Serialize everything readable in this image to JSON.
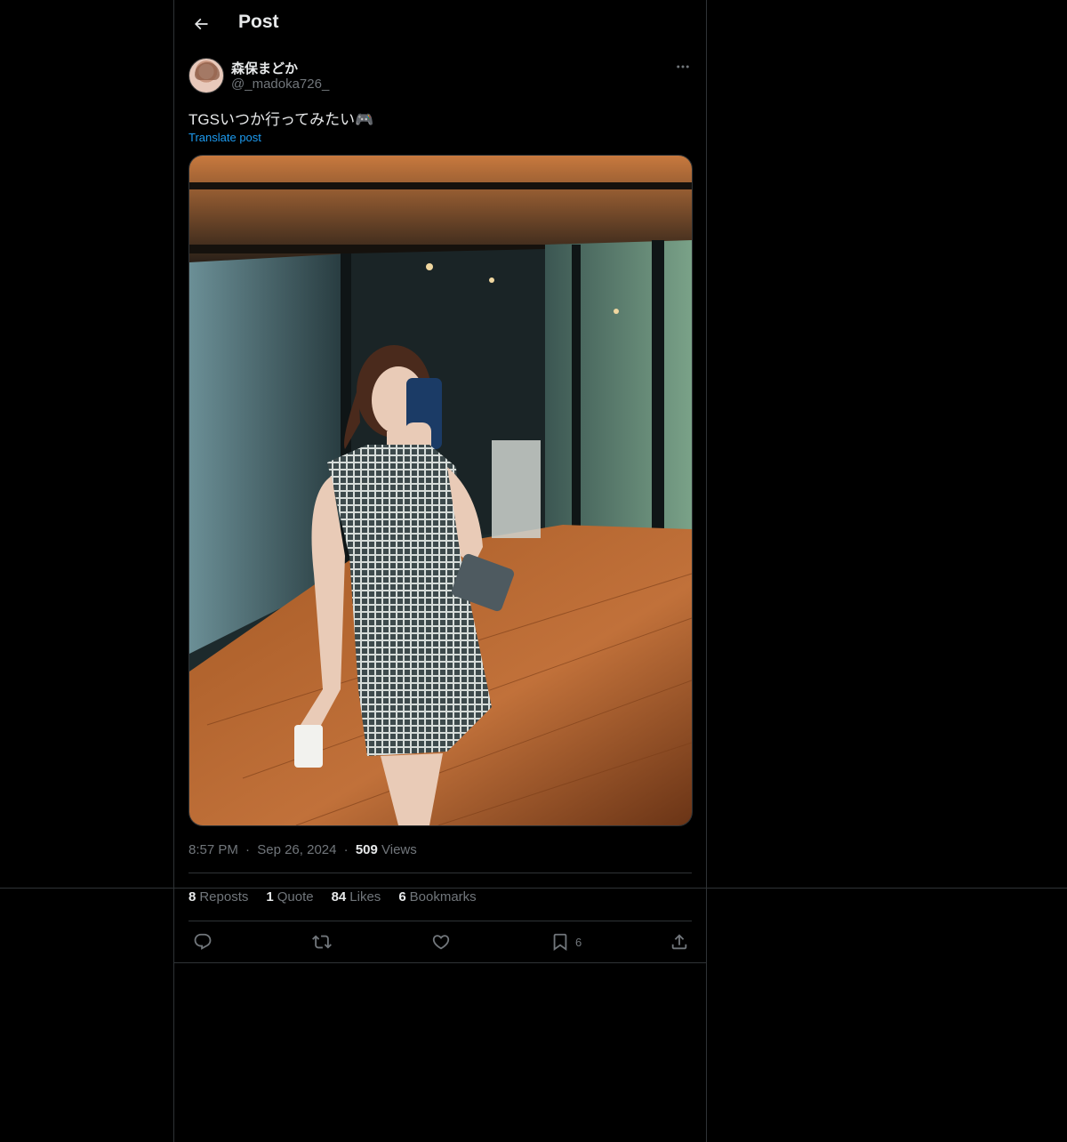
{
  "header": {
    "title": "Post"
  },
  "post": {
    "author": {
      "display_name": "森保まどか",
      "handle": "@_madoka726_"
    },
    "text": "TGSいつか行ってみたい🎮",
    "translate_label": "Translate post",
    "time": "8:57 PM",
    "date": "Sep 26, 2024",
    "separator": "·",
    "views_count": "509",
    "views_label": "Views"
  },
  "stats": {
    "reposts": {
      "count": "8",
      "label": "Reposts"
    },
    "quotes": {
      "count": "1",
      "label": "Quote"
    },
    "likes": {
      "count": "84",
      "label": "Likes"
    },
    "bookmarks": {
      "count": "6",
      "label": "Bookmarks"
    }
  },
  "actions": {
    "reply_icon": "reply-icon",
    "repost_icon": "repost-icon",
    "like_icon": "heart-icon",
    "bookmark_icon": "bookmark-icon",
    "bookmark_count": "6",
    "share_icon": "share-icon"
  },
  "colors": {
    "background": "#000000",
    "text_primary": "#e7e9ea",
    "text_secondary": "#71767b",
    "link": "#1d9bf0",
    "border": "#2f3336"
  }
}
